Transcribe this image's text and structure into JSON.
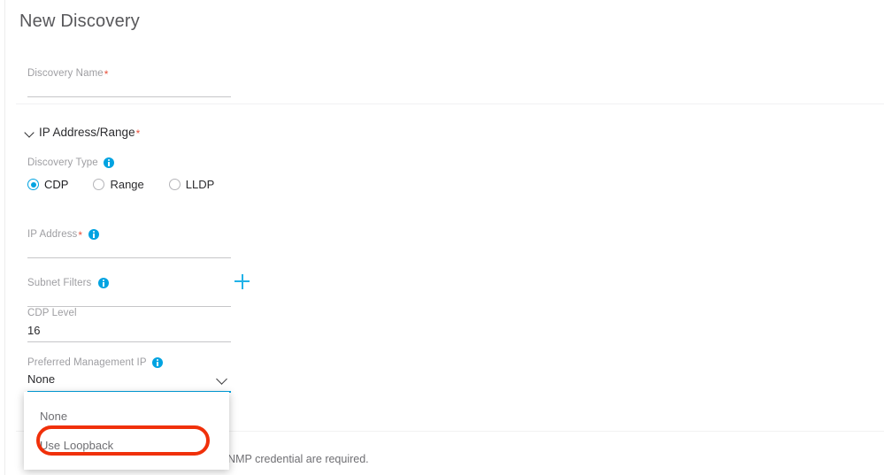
{
  "page": {
    "title": "New Discovery"
  },
  "fields": {
    "discovery_name": {
      "label": "Discovery Name",
      "required_marker": "*",
      "value": ""
    },
    "ip_address": {
      "label": "IP Address",
      "required_marker": "*",
      "info_icon": "info-icon",
      "value": ""
    },
    "subnet_filters": {
      "label": "Subnet Filters",
      "info_icon": "info-icon",
      "value": "",
      "add_icon": "plus-icon"
    },
    "cdp_level": {
      "label": "CDP Level",
      "value": "16"
    },
    "preferred_management_ip": {
      "label": "Preferred Management IP",
      "info_icon": "info-icon",
      "value": "None",
      "chevron_icon": "chevron-down-icon",
      "options": [
        {
          "label": "None"
        },
        {
          "label": "Use Loopback"
        }
      ]
    }
  },
  "section": {
    "chevron_icon": "chevron-down-icon",
    "title": "IP Address/Range",
    "required_marker": "*",
    "discovery_type": {
      "label": "Discovery Type",
      "info_icon": "info-icon",
      "options": [
        {
          "label": "CDP",
          "checked": true
        },
        {
          "label": "Range",
          "checked": false
        },
        {
          "label": "LLDP",
          "checked": false
        }
      ]
    }
  },
  "footer": {
    "info_icon": "info-icon",
    "note": "At least one CLI credential and one SNMP credential are required."
  },
  "colors": {
    "accent": "#00a3e1",
    "required": "#e8503a",
    "annotation": "#f0300a",
    "text": "#2b2b2e",
    "muted": "#9e9ea2"
  }
}
